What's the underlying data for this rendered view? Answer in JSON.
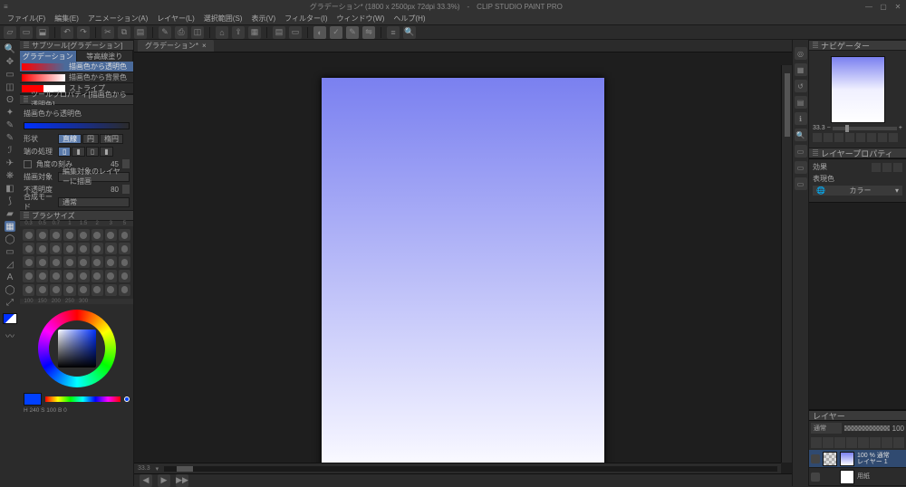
{
  "app": {
    "title": "グラデーション* (1800 x 2500px 72dpi 33.3%)　-　CLIP STUDIO PAINT PRO"
  },
  "menu": [
    "ファイル(F)",
    "編集(E)",
    "アニメーション(A)",
    "レイヤー(L)",
    "選択範囲(S)",
    "表示(V)",
    "フィルター(I)",
    "ウィンドウ(W)",
    "ヘルプ(H)"
  ],
  "doc": {
    "tab": "グラデーション*",
    "zoom_text": "33.3"
  },
  "subtool": {
    "title": "サブツール[グラデーション]",
    "tabs": [
      "グラデーション",
      "等高線塗り"
    ],
    "items": [
      {
        "label": "描画色から透明色"
      },
      {
        "label": "描画色から背景色"
      },
      {
        "label": "ストライプ"
      }
    ]
  },
  "toolprop": {
    "title": "ツールプロパティ[描画色から透明色]",
    "grad_label": "描画色から透明色",
    "shape_label": "形状",
    "shapes": [
      "直線",
      "円",
      "楕円"
    ],
    "edge_label": "端の処理",
    "angle_check": "角度の刻み",
    "angle_val": "45",
    "target_label": "描画対象",
    "target_val": "編集対象のレイヤーに描画",
    "opacity_label": "不透明度",
    "opacity_val": "80",
    "blend_label": "合成モード",
    "blend_val": "通常"
  },
  "brushsize": {
    "title": "ブラシサイズ",
    "row1": [
      "0.3",
      "0.5",
      "0.7",
      "1",
      "1.5",
      "2",
      "3",
      "5"
    ],
    "row5": [
      "100",
      "150",
      "200",
      "250",
      "300"
    ]
  },
  "colorwheel": {
    "hsv": "H 240 S 100 B 0"
  },
  "navigator": {
    "title": "ナビゲーター",
    "zoom": "33.3"
  },
  "layerprop": {
    "title": "レイヤープロパティ",
    "effect": "効果",
    "mode_label": "表現色",
    "mode_val": "カラー"
  },
  "layers": {
    "title": "レイヤー",
    "blend": "通常",
    "opacity": "100",
    "items": [
      {
        "info": "100 % 通常",
        "name": "レイヤー 1"
      },
      {
        "info": "",
        "name": "用紙"
      }
    ]
  }
}
